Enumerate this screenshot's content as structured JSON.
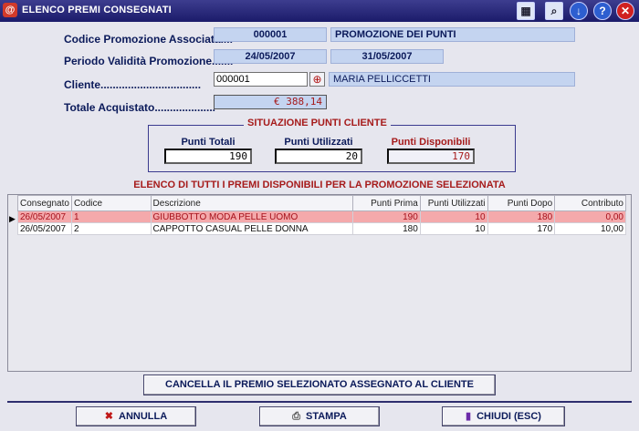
{
  "window": {
    "title": "ELENCO PREMI CONSEGNATI"
  },
  "form": {
    "codice_label": "Codice Promozione Associata....",
    "codice_value": "000001",
    "promo_name": "PROMOZIONE DEI PUNTI",
    "periodo_label": "Periodo Validità Promozione.......",
    "periodo_from": "24/05/2007",
    "periodo_to": "31/05/2007",
    "cliente_label": "Cliente.................................",
    "cliente_code": "000001",
    "cliente_name": "MARIA PELLICCETTI",
    "totale_label": "Totale Acquistato....................",
    "totale_value": "€ 388,14"
  },
  "points": {
    "group_title": "SITUAZIONE PUNTI CLIENTE",
    "totali_label": "Punti Totali",
    "totali_value": "190",
    "utilizzati_label": "Punti Utilizzati",
    "utilizzati_value": "20",
    "disponibili_label": "Punti Disponibili",
    "disponibili_value": "170"
  },
  "list": {
    "title": "ELENCO DI TUTTI I PREMI DISPONIBILI PER LA PROMOZIONE SELEZIONATA",
    "columns": [
      "Consegnato",
      "Codice",
      "Descrizione",
      "Punti Prima",
      "Punti Utilizzati",
      "Punti Dopo",
      "Contributo"
    ],
    "rows": [
      [
        "26/05/2007",
        "1",
        "GIUBBOTTO MODA PELLE UOMO",
        "190",
        "10",
        "180",
        "0,00"
      ],
      [
        "26/05/2007",
        "2",
        "CAPPOTTO CASUAL PELLE DONNA",
        "180",
        "10",
        "170",
        "10,00"
      ]
    ]
  },
  "buttons": {
    "cancella": "CANCELLA IL PREMIO SELEZIONATO ASSEGNATO AL CLIENTE",
    "annulla": "ANNULLA",
    "stampa": "STAMPA",
    "chiudi": "CHIUDI (ESC)"
  },
  "colors": {
    "titlebar": "#1b1b6a",
    "selected_row": "#f4a9ab",
    "accent_red": "#a61b1b"
  }
}
